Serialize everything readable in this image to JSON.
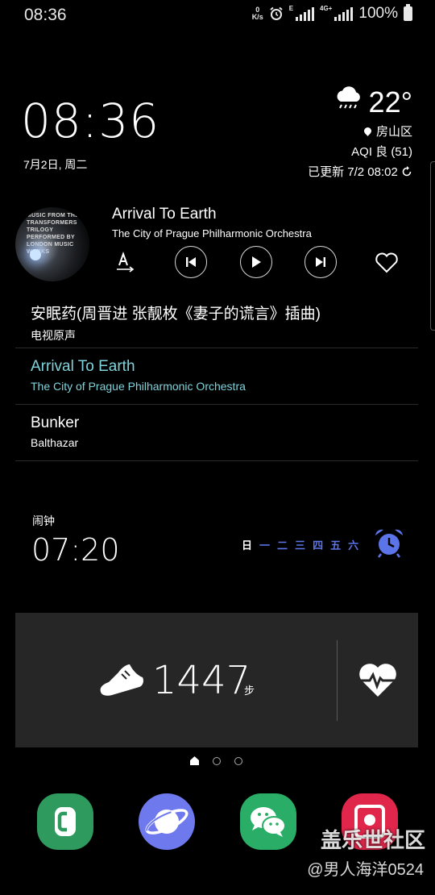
{
  "status_bar": {
    "time": "08:36",
    "speed_value": "0",
    "speed_unit": "K/s",
    "network_1": "E",
    "network_2": "4G+",
    "battery": "100%"
  },
  "lockscreen": {
    "clock": "08:36",
    "date": "7月2日, 周二"
  },
  "weather": {
    "temperature": "22°",
    "icon": "rain-cloud-icon",
    "location": "房山区",
    "aqi": "AQI 良 (51)",
    "updated": "已更新 7/2 08:02"
  },
  "music": {
    "album_art_text": "MUSIC FROM THE TRANSFORMERS TRILOGY PERFORMED BY LONDON MUSIC WORKS",
    "now_playing_title": "Arrival To Earth",
    "now_playing_artist": "The City of Prague Philharmonic Orchestra",
    "controls": [
      "lyrics-icon",
      "previous-icon",
      "play-icon",
      "next-icon",
      "favorite-icon"
    ],
    "playlist": [
      {
        "title": "安眠药(周晋进 张靓枚《妻子的谎言》插曲)",
        "subtitle": "电视原声",
        "active": false
      },
      {
        "title": "Arrival To Earth",
        "subtitle": "The City of Prague Philharmonic Orchestra",
        "active": true
      },
      {
        "title": "Bunker",
        "subtitle": "Balthazar",
        "active": false
      }
    ]
  },
  "alarm": {
    "label": "闹钟",
    "time": "07:20",
    "days": [
      {
        "label": "日",
        "on": false
      },
      {
        "label": "一",
        "on": true
      },
      {
        "label": "二",
        "on": true
      },
      {
        "label": "三",
        "on": true
      },
      {
        "label": "四",
        "on": true
      },
      {
        "label": "五",
        "on": true
      },
      {
        "label": "六",
        "on": true
      }
    ],
    "accent_color": "#5b74e8"
  },
  "health": {
    "steps": "1447",
    "unit": "步"
  },
  "dock": {
    "apps": [
      "phone-app-icon",
      "internet-app-icon",
      "wechat-app-icon",
      "screen-recorder-app-icon"
    ]
  },
  "watermark": {
    "site": "盖乐世社区",
    "user": "@男人海洋0524"
  },
  "colors": {
    "playing_highlight": "#7fd4dc",
    "card_bg": "#262626"
  }
}
